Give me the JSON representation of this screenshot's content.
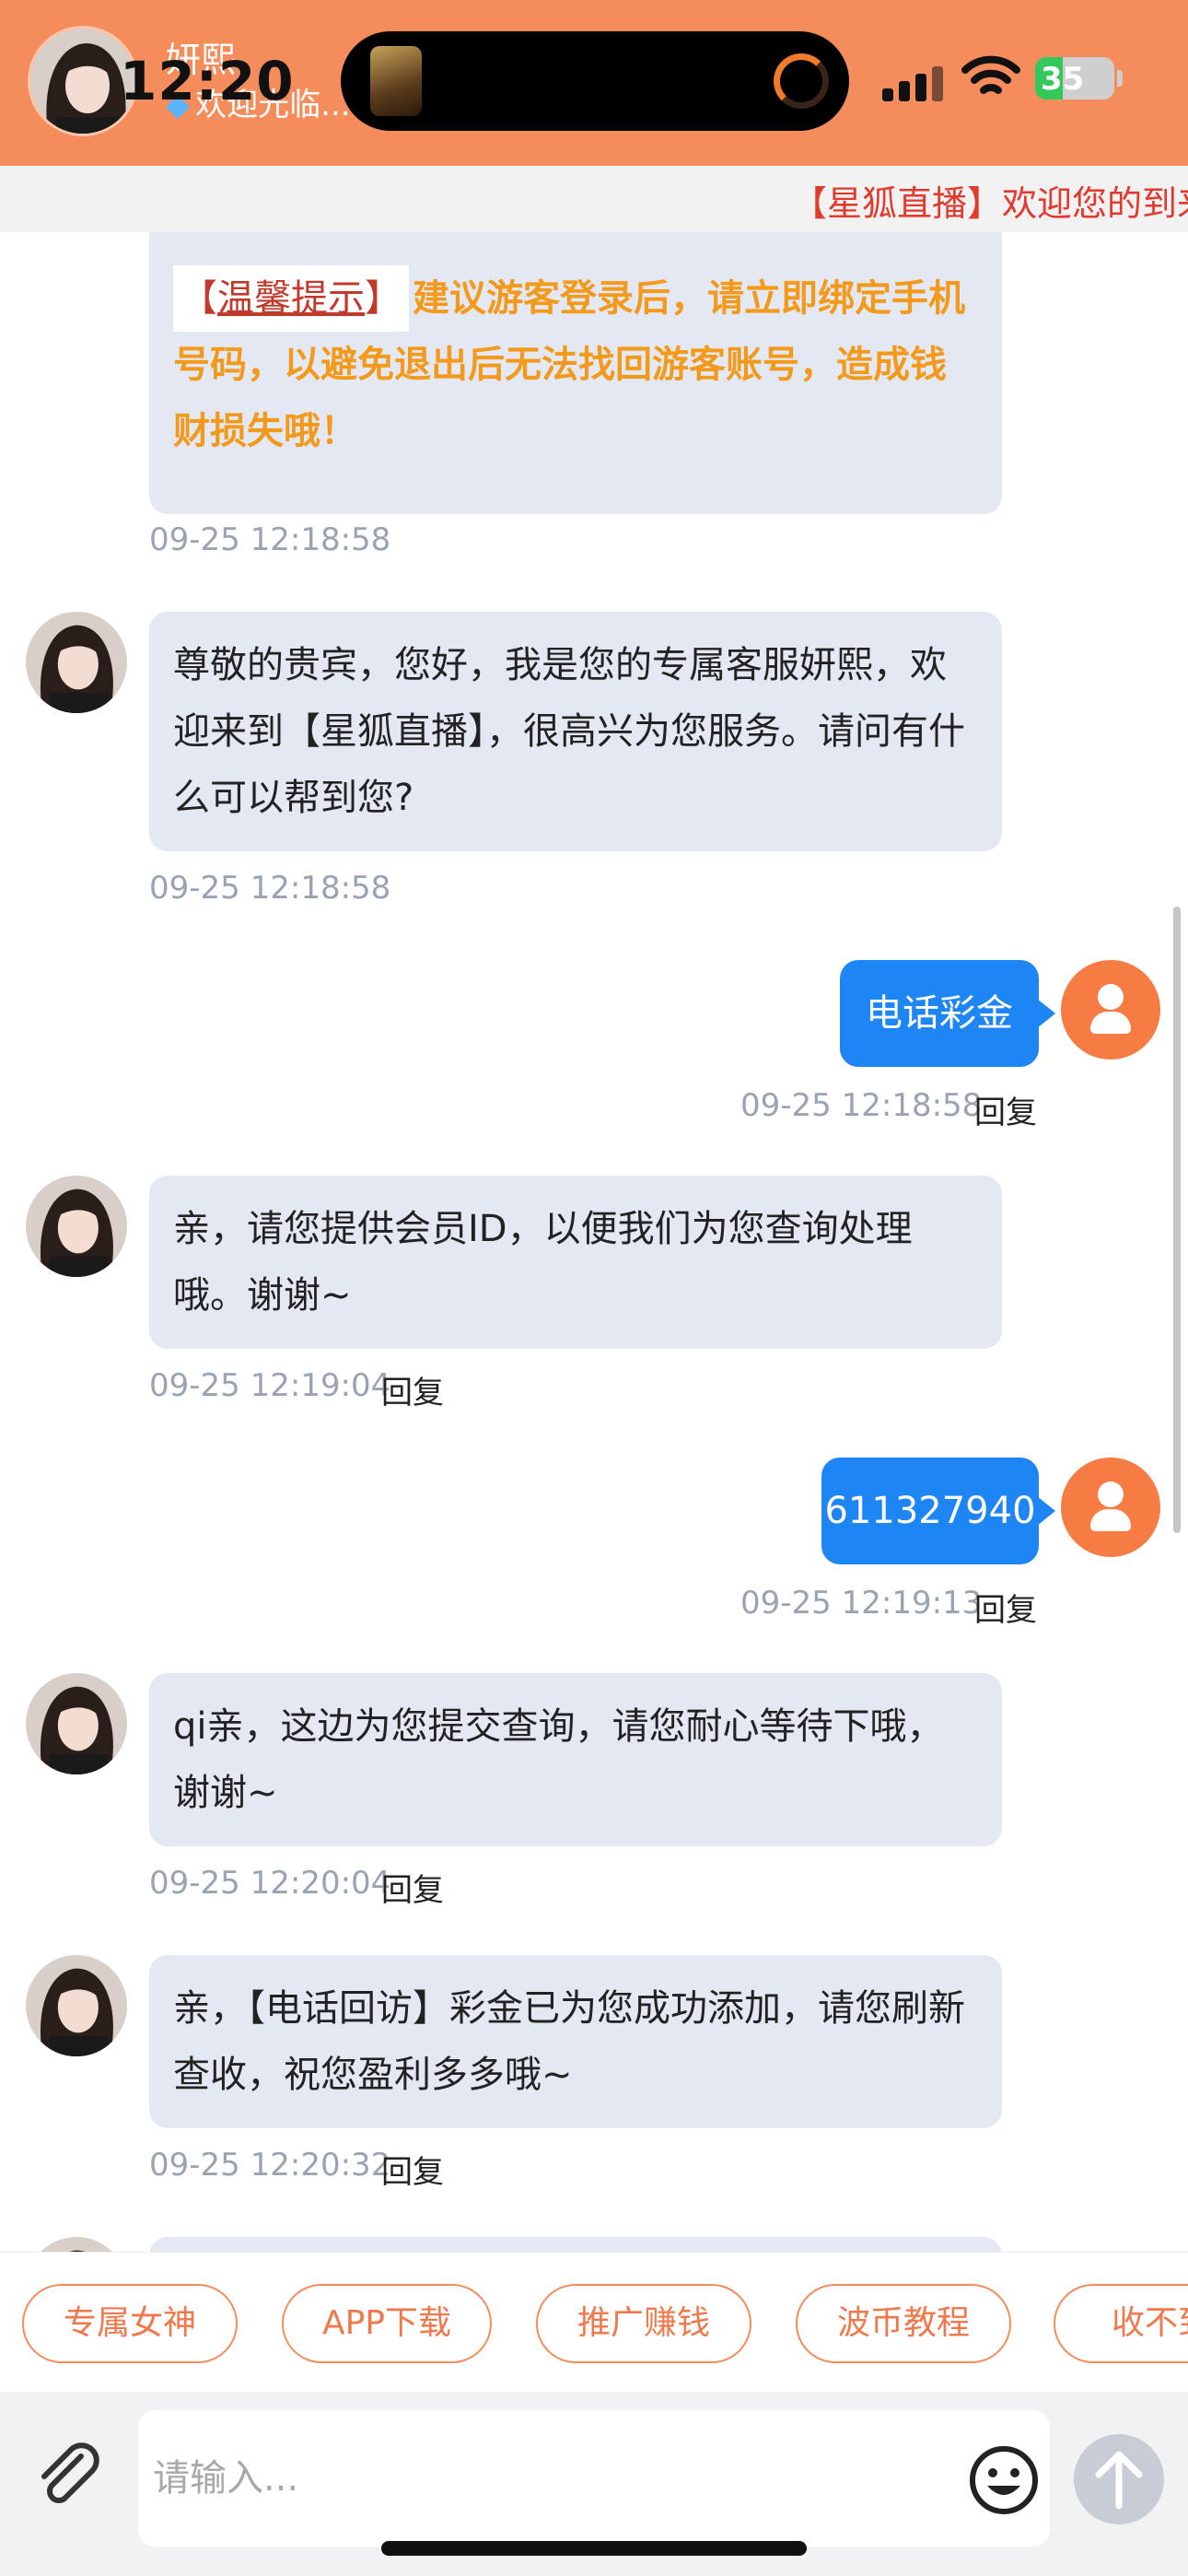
{
  "status_bar": {
    "time": "12:20",
    "battery": "35"
  },
  "header": {
    "agent_name": "妍熙",
    "welcome": "欢迎光临..."
  },
  "marquee": {
    "text": "【星狐直播】欢迎您的到来"
  },
  "messages": [
    {
      "side": "in",
      "tip_label": "温馨提示",
      "text": "建议游客登录后，请立即绑定手机号码，以避免退出后无法找回游客账号，造成钱财损失哦！",
      "time": "09-25 12:18:58"
    },
    {
      "side": "in",
      "text": "尊敬的贵宾，您好，我是您的专属客服妍熙，欢迎来到【星狐直播】，很高兴为您服务。请问有什么可以帮到您?",
      "time": "09-25 12:18:58"
    },
    {
      "side": "out",
      "text": "电话彩金",
      "time": "09-25 12:18:58",
      "reply": "回复"
    },
    {
      "side": "in",
      "text": "亲，请您提供会员ID，以便我们为您查询处理哦。谢谢~",
      "time": "09-25 12:19:04",
      "reply": "回复"
    },
    {
      "side": "out",
      "text": "611327940",
      "time": "09-25 12:19:13",
      "reply": "回复"
    },
    {
      "side": "in",
      "text": "qi亲，这边为您提交查询，请您耐心等待下哦，谢谢~",
      "time": "09-25 12:20:04",
      "reply": "回复"
    },
    {
      "side": "in",
      "text": "亲，【电话回访】彩金已为您成功添加，请您刷新查收，祝您盈利多多哦~",
      "time": "09-25 12:20:32",
      "reply": "回复"
    }
  ],
  "quick_replies": [
    "专属女神",
    "APP下载",
    "推广赚钱",
    "波币教程",
    "收不到"
  ],
  "input": {
    "placeholder": "请输入..."
  },
  "icons": {
    "attach": "paperclip-icon",
    "emoji": "smiley-icon",
    "send": "arrow-up-icon",
    "user": "person-icon"
  },
  "colors": {
    "header": "#f58c5c",
    "bubble_in": "#e3e8f3",
    "bubble_out": "#1e86f4",
    "tip_text": "#f39a1c",
    "marquee_text": "#e23a2e"
  }
}
